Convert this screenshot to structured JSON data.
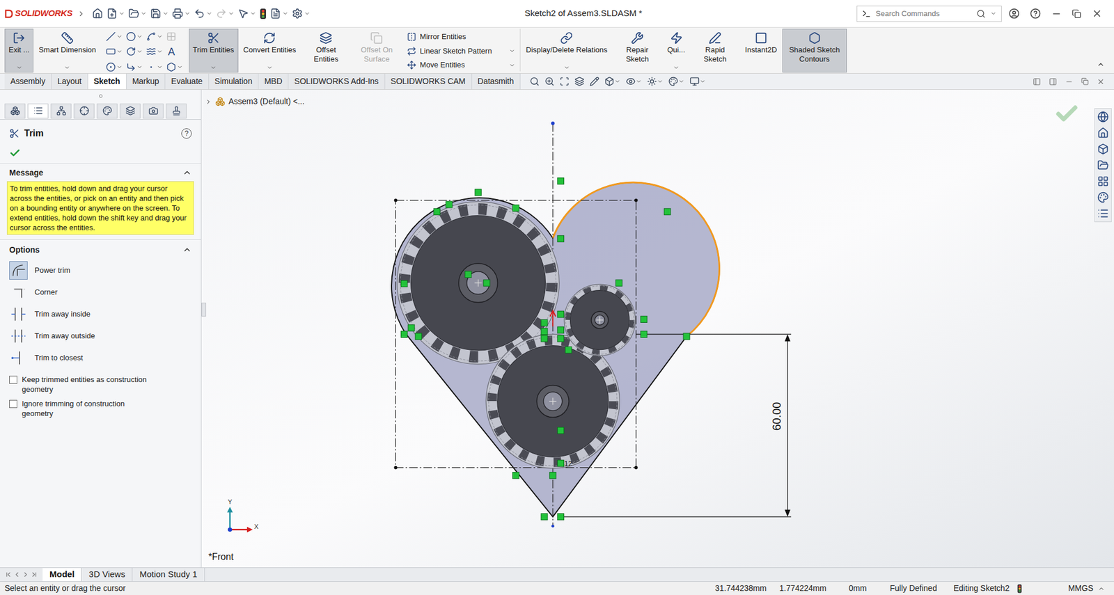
{
  "app": {
    "logo": "SOLIDWORKS"
  },
  "window": {
    "title": "Sketch2 of Assem3.SLDASM *"
  },
  "search": {
    "placeholder": "Search Commands"
  },
  "ribbon": {
    "items": [
      {
        "kind": "wide",
        "label": "Exit ...",
        "pressed": true,
        "disabled": false,
        "dropdown": true
      },
      {
        "kind": "wide",
        "label": "Smart Dimension",
        "pressed": false,
        "disabled": false,
        "dropdown": true
      },
      {
        "kind": "tools",
        "glyph": "A"
      },
      {
        "kind": "wide",
        "label": "Trim Entities",
        "pressed": true,
        "disabled": false,
        "dropdown": true
      },
      {
        "kind": "wide",
        "label": "Convert Entities",
        "pressed": false,
        "disabled": false,
        "dropdown": true
      },
      {
        "kind": "narrow",
        "label": "Offset Entities",
        "pressed": false,
        "disabled": false,
        "dropdown": false
      },
      {
        "kind": "narrow",
        "label": "Offset On Surface",
        "pressed": false,
        "disabled": true,
        "dropdown": false
      },
      {
        "kind": "stack",
        "items": [
          {
            "label": "Mirror Entities",
            "dropdown": false
          },
          {
            "label": "Linear Sketch Pattern",
            "dropdown": true
          },
          {
            "label": "Move Entities",
            "dropdown": true
          }
        ]
      },
      {
        "kind": "wide",
        "label": "Display/Delete Relations",
        "pressed": false,
        "disabled": false,
        "dropdown": true
      },
      {
        "kind": "narrow",
        "label": "Repair Sketch",
        "pressed": false,
        "disabled": false,
        "dropdown": false
      },
      {
        "kind": "narrow",
        "label": "Qui...",
        "pressed": false,
        "disabled": false,
        "dropdown": true
      },
      {
        "kind": "narrow",
        "label": "Rapid Sketch",
        "pressed": false,
        "disabled": false,
        "dropdown": false
      },
      {
        "kind": "wide",
        "label": "Instant2D",
        "pressed": false,
        "disabled": false,
        "dropdown": false
      },
      {
        "kind": "medium",
        "label": "Shaded Sketch Contours",
        "pressed": true,
        "disabled": false,
        "dropdown": false
      }
    ]
  },
  "tabs": [
    {
      "label": "Assembly",
      "selected": false
    },
    {
      "label": "Layout",
      "selected": false
    },
    {
      "label": "Sketch",
      "selected": true
    },
    {
      "label": "Markup",
      "selected": false
    },
    {
      "label": "Evaluate",
      "selected": false
    },
    {
      "label": "Simulation",
      "selected": false
    },
    {
      "label": "MBD",
      "selected": false
    },
    {
      "label": "SOLIDWORKS Add-Ins",
      "selected": false
    },
    {
      "label": "SOLIDWORKS CAM",
      "selected": false
    },
    {
      "label": "Datasmith",
      "selected": false
    }
  ],
  "feature_tree": {
    "label": "Assem3 (Default) <..."
  },
  "property_manager": {
    "title": "Trim",
    "help": "?",
    "message": {
      "title": "Message",
      "expanded": true,
      "text": "To trim entities, hold down and drag your cursor across the entities, or pick on an entity and then pick on a bounding entity or anywhere on the screen.  To extend entities, hold down the shift key and drag your cursor across the entities."
    },
    "options": {
      "title": "Options",
      "expanded": true,
      "items": [
        {
          "label": "Power trim",
          "selected": true
        },
        {
          "label": "Corner",
          "selected": false
        },
        {
          "label": "Trim away inside",
          "selected": false
        },
        {
          "label": "Trim away outside",
          "selected": false
        },
        {
          "label": "Trim to closest",
          "selected": false
        }
      ],
      "checkboxes": [
        {
          "label": "Keep trimmed entities as construction geometry",
          "checked": false
        },
        {
          "label": "Ignore trimming of construction geometry",
          "checked": false
        }
      ]
    }
  },
  "sketch": {
    "dimension": "60.00",
    "relation_label": "12",
    "view_label": "*Front",
    "triad": {
      "x": "X",
      "y": "Y"
    }
  },
  "bottom_tabs": [
    {
      "label": "Model",
      "selected": true
    },
    {
      "label": "3D Views",
      "selected": false
    },
    {
      "label": "Motion Study 1",
      "selected": false
    }
  ],
  "status_bar": {
    "message": "Select an entity or drag the cursor",
    "x": "31.744238mm",
    "y": "1.774224mm",
    "z": "0mm",
    "state": "Fully Defined",
    "mode": "Editing Sketch2",
    "units": "MMGS"
  }
}
